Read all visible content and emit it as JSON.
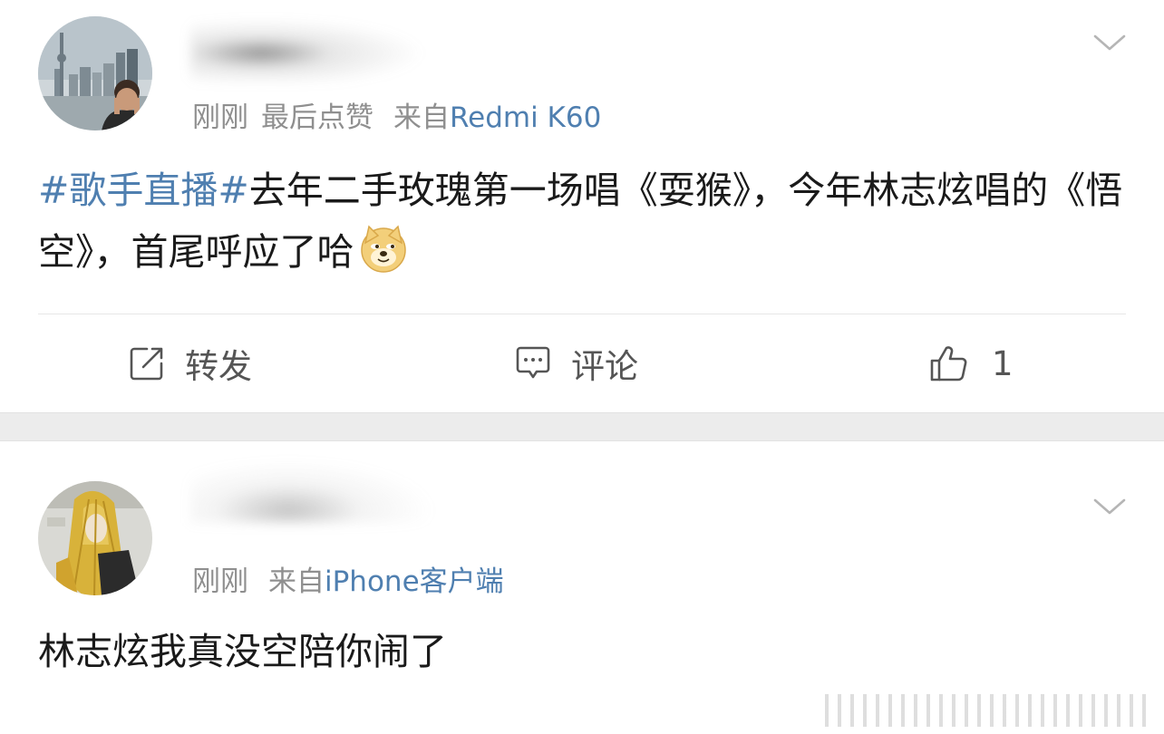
{
  "posts": [
    {
      "username": "",
      "time": "刚刚",
      "action": "最后点赞",
      "from_prefix": "来自",
      "device": "Redmi K60",
      "hashtag": "#歌手直播#",
      "text": "去年二手玫瑰第一场唱《耍猴》，今年林志炫唱的《悟空》，首尾呼应了哈",
      "emoji": "doge-emoji",
      "repost_label": "转发",
      "comment_label": "评论",
      "like_count": "1"
    },
    {
      "username": "",
      "time": "刚刚",
      "from_prefix": "来自",
      "device": "iPhone客户端",
      "text": "林志炫我真没空陪你闹了"
    }
  ],
  "colors": {
    "link": "#4f7fb0",
    "meta": "#8f8f8f",
    "text": "#1a1a1a",
    "separator": "#ececec"
  },
  "icons": [
    "chevron-down-icon",
    "repost-icon",
    "comment-icon",
    "thumbs-up-icon"
  ]
}
